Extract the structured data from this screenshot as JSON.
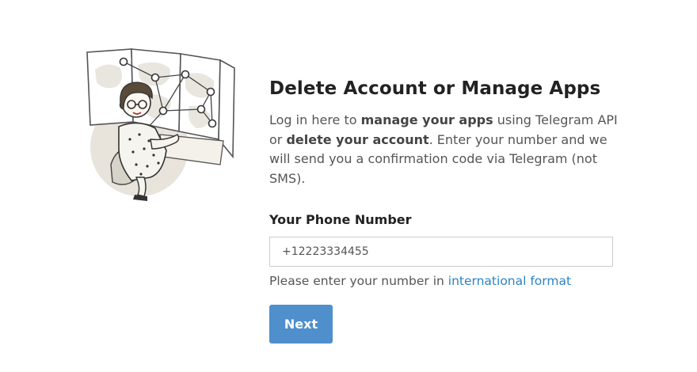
{
  "main": {
    "title": "Delete Account or Manage Apps",
    "description": {
      "part1": "Log in here to ",
      "bold1": "manage your apps",
      "part2": " using Telegram API or ",
      "bold2": "delete your account",
      "part3": ". Enter your number and we will send you a confirmation code via Telegram (not SMS)."
    },
    "phone_label": "Your Phone Number",
    "phone_input": {
      "value": "",
      "placeholder": "+12223334455"
    },
    "hint": {
      "text": "Please enter your number in ",
      "link": "international format"
    },
    "next_label": "Next"
  },
  "colors": {
    "accent": "#4f8fcc",
    "link": "#2d83c4"
  },
  "illustration": {
    "icon": "woman-with-network-map-illustration"
  }
}
